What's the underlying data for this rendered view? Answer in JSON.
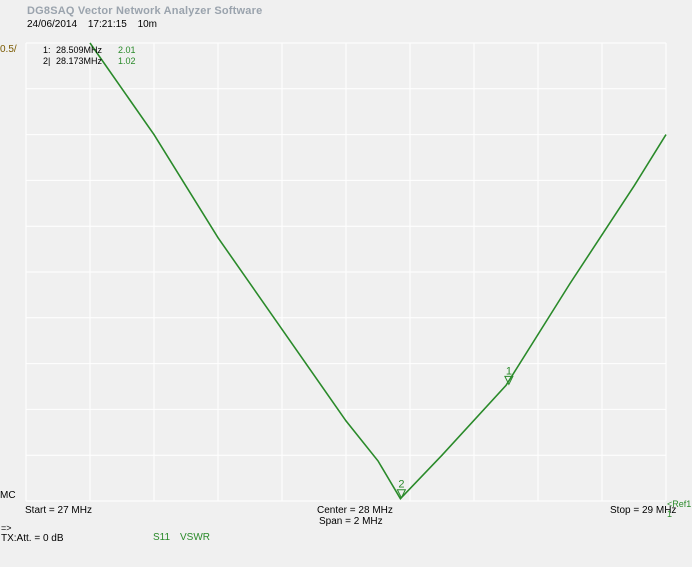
{
  "header": {
    "app_title": "DG8SAQ Vector Network Analyzer Software",
    "date": "24/06/2014",
    "time": "17:21:15",
    "note": "10m"
  },
  "scale": {
    "top_label": "0.5/",
    "bottom_label": "MC"
  },
  "markers": [
    {
      "id": "1:",
      "freq": "28.509MHz",
      "value": "2.01"
    },
    {
      "id": "2|",
      "freq": "28.173MHz",
      "value": "1.02"
    }
  ],
  "footer": {
    "start": "Start = 27 MHz",
    "center": "Center = 28 MHz",
    "span": "Span = 2 MHz",
    "stop": "Stop = 29 MHz",
    "ref_label": "<Ref1",
    "ref_num": "1",
    "arrow": "=>",
    "tx_att": "TX:Att. = 0 dB",
    "trace_param": "S11",
    "trace_format": "VSWR"
  },
  "marker_labels": [
    "1",
    "2"
  ],
  "colors": {
    "trace": "#2a8a2a",
    "grid": "#ffffff",
    "plot_bg": "#f0f0f0"
  },
  "chart_data": {
    "type": "line",
    "xlabel": "",
    "ylabel": "",
    "xlim": [
      27,
      29
    ],
    "ylim": [
      1,
      5
    ],
    "grid": true,
    "series": [
      {
        "name": "S11",
        "x": [
          27.2,
          27.4,
          27.6,
          27.8,
          28.0,
          28.1,
          28.17,
          28.3,
          28.5,
          28.7,
          28.9,
          29.0
        ],
        "y": [
          5.0,
          4.2,
          3.3,
          2.5,
          1.7,
          1.35,
          1.02,
          1.4,
          2.01,
          2.9,
          3.75,
          4.2
        ]
      }
    ],
    "markers": [
      {
        "label": "1",
        "x": 28.509,
        "y": 2.01
      },
      {
        "label": "2",
        "x": 28.173,
        "y": 1.02
      }
    ]
  }
}
